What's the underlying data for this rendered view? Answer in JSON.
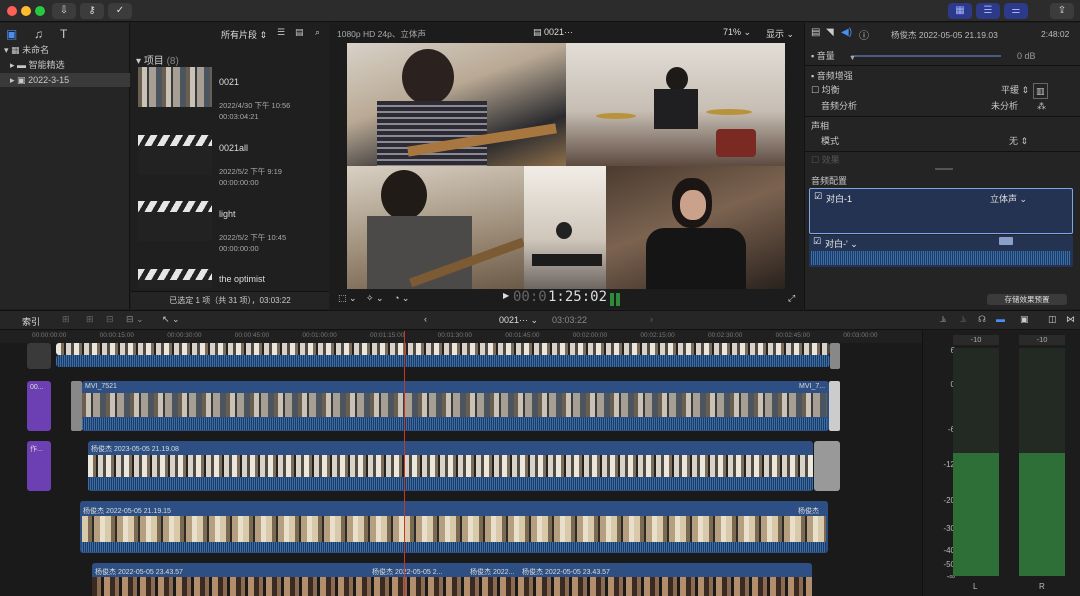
{
  "toolbar": {
    "import_icon": "download-arrow-icon",
    "keywords_icon": "key-icon",
    "analyze_icon": "checkmark-circle-icon",
    "share_icon": "share-icon"
  },
  "library": {
    "root": "未命名",
    "items": [
      {
        "label": "智能精选"
      },
      {
        "label": "2022-3-15"
      }
    ]
  },
  "browser": {
    "filter": "所有片段",
    "section_title": "项目",
    "section_count": "(8)",
    "clips": [
      {
        "title": "0021",
        "date": "2022/4/30 下午 10:56",
        "duration": "00:03:04:21",
        "thumb": "video"
      },
      {
        "title": "0021all",
        "date": "2022/5/2 下午 9:19",
        "duration": "00:00:00:00",
        "thumb": "slate"
      },
      {
        "title": "light",
        "date": "2022/5/2 下午 10:45",
        "duration": "00:00:00:00",
        "thumb": "slate"
      },
      {
        "title": "the optimist",
        "date": "",
        "duration": "",
        "thumb": "slate"
      }
    ],
    "status": "已选定 1 项（共 31 项），03:03:22"
  },
  "viewer": {
    "format": "1080p HD 24p、立体声",
    "clip_name": "0021···",
    "zoom": "71%",
    "display_menu": "显示",
    "timecode_dim": "00:0",
    "timecode": "1:25:02"
  },
  "inspector": {
    "clip_name": "杨俊杰 2022-05-05 21.19.03",
    "duration": "2:48:02",
    "volume_label": "音量",
    "volume_value": "0 dB",
    "enhance_title": "音频增强",
    "eq_label": "均衡",
    "eq_value": "平缓",
    "analysis_label": "音频分析",
    "analysis_value": "未分析",
    "pan_title": "声相",
    "mode_label": "模式",
    "mode_value": "无",
    "effects_label": "效果",
    "config_title": "音频配置",
    "role1_label": "对白-1",
    "role1_value": "立体声",
    "role2_label": "对白-'",
    "save_preset": "存储效果预置"
  },
  "timeline_bar": {
    "index_label": "索引",
    "project_name": "0021···",
    "project_duration": "03:03:22"
  },
  "ruler": {
    "ticks": [
      "00:00:00:00",
      "00:00:15:00",
      "00:00:30:00",
      "00:00:45:00",
      "00:01:00:00",
      "00:01:15:00",
      "00:01:30:00",
      "00:01:45:00",
      "00:02:00:00",
      "00:02:15:00",
      "00:02:30:00",
      "00:02:45:00",
      "00:03:00:00"
    ]
  },
  "tracks": {
    "t1_label": "MVI_7521",
    "t1_end": "MVI_7...",
    "t1_side": "00...",
    "t2_label": "杨俊杰 2023-05-05 21.19.08",
    "t2_side": "作...",
    "t3_label": "杨俊杰 2022-05-05 21.19.15",
    "t3_end": "杨俊杰",
    "t4_labels": [
      "杨俊杰 2022-05-05 23.43.57",
      "杨俊杰 2022-05-05 2...",
      "杨俊杰 2022...",
      "杨俊杰 2022-05-05 23.43.57"
    ]
  },
  "meters": {
    "peak_l": "-10",
    "peak_r": "-10",
    "scale": [
      "6",
      "0",
      "-6",
      "-12",
      "-20",
      "-30",
      "-40",
      "-50",
      "-∞"
    ],
    "channel_l": "L",
    "channel_r": "R",
    "level_fraction": 0.54
  },
  "colors": {
    "accent": "#3b79d8",
    "purple_clip": "#6c3fb2",
    "playhead": "#c0392b"
  }
}
